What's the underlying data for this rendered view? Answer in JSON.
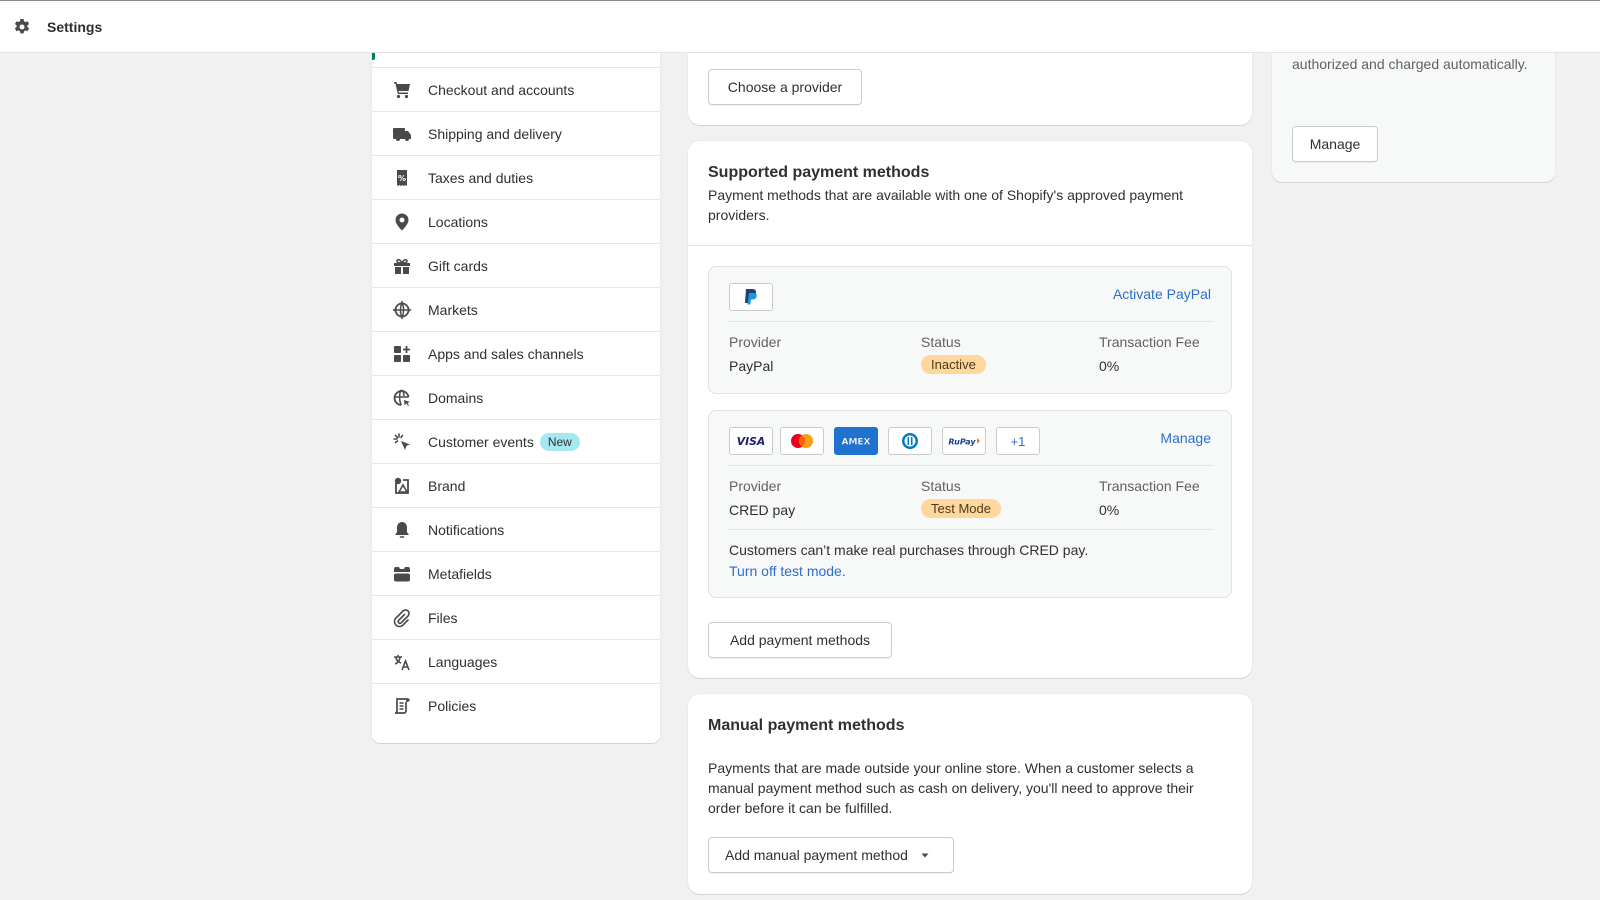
{
  "topbar": {
    "title": "Settings",
    "icon": "gear-icon"
  },
  "sidebar": {
    "items": [
      {
        "label": "Checkout and accounts",
        "icon": "cart-icon"
      },
      {
        "label": "Shipping and delivery",
        "icon": "truck-icon"
      },
      {
        "label": "Taxes and duties",
        "icon": "tax-receipt-icon"
      },
      {
        "label": "Locations",
        "icon": "location-pin-icon"
      },
      {
        "label": "Gift cards",
        "icon": "gift-icon"
      },
      {
        "label": "Markets",
        "icon": "globe-market-icon"
      },
      {
        "label": "Apps and sales channels",
        "icon": "apps-icon"
      },
      {
        "label": "Domains",
        "icon": "globe-domains-icon"
      },
      {
        "label": "Customer events",
        "icon": "cursor-click-icon",
        "badge": "New"
      },
      {
        "label": "Brand",
        "icon": "brand-icon"
      },
      {
        "label": "Notifications",
        "icon": "bell-icon"
      },
      {
        "label": "Metafields",
        "icon": "metafields-icon"
      },
      {
        "label": "Files",
        "icon": "paperclip-icon"
      },
      {
        "label": "Languages",
        "icon": "translate-icon"
      },
      {
        "label": "Policies",
        "icon": "policy-scroll-icon"
      }
    ]
  },
  "provider_card": {
    "choose_provider_label": "Choose a provider"
  },
  "supported": {
    "title": "Supported payment methods",
    "description": "Payment methods that are available with one of Shopify's approved payment providers.",
    "col_provider": "Provider",
    "col_status": "Status",
    "col_fee": "Transaction Fee",
    "paypal": {
      "action": "Activate PayPal",
      "provider": "PayPal",
      "status": "Inactive",
      "fee": "0%"
    },
    "cred": {
      "action": "Manage",
      "provider": "CRED pay",
      "status": "Test Mode",
      "fee": "0%",
      "logos": [
        "VISA",
        "Mastercard",
        "AMEX",
        "Diners Club",
        "RuPay",
        "+1"
      ],
      "note": "Customers can’t make real purchases through CRED pay.",
      "turn_off_link": "Turn off test mode."
    },
    "add_button": "Add payment methods"
  },
  "manual": {
    "title": "Manual payment methods",
    "description": "Payments that are made outside your online store. When a customer selects a manual payment method such as cash on delivery, you'll need to approve their order before it can be fulfilled.",
    "add_button": "Add manual payment method"
  },
  "right_card": {
    "text": "The customer's payment method is authorized and charged automatically.",
    "manage_button": "Manage"
  },
  "colors": {
    "link": "#2c6ecb",
    "status_badge": "#ffd79d",
    "new_badge": "#a4e8f2",
    "active_marker": "#008060"
  }
}
